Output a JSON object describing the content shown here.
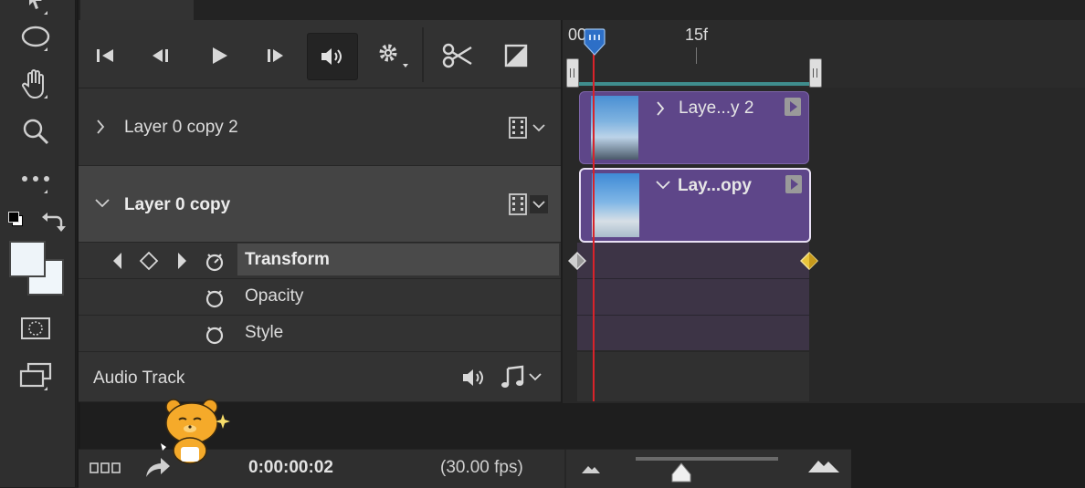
{
  "transport": {
    "buttons": [
      "go-to-first-frame",
      "previous-frame",
      "play",
      "next-frame",
      "mute-audio",
      "settings",
      "split-at-playhead",
      "transition"
    ]
  },
  "layers": [
    {
      "name": "Layer 0 copy 2",
      "expanded": false,
      "selected": false
    },
    {
      "name": "Layer 0 copy",
      "expanded": true,
      "selected": true
    }
  ],
  "properties": [
    {
      "name": "Transform",
      "highlighted": true
    },
    {
      "name": "Opacity",
      "highlighted": false
    },
    {
      "name": "Style",
      "highlighted": false
    }
  ],
  "audio_track": {
    "label": "Audio Track"
  },
  "ruler": {
    "start_label": "00",
    "mid_label": "15f"
  },
  "clips": [
    {
      "label": "Laye...y 2"
    },
    {
      "label": "Lay...opy"
    }
  ],
  "status": {
    "timecode": "0:00:00:02",
    "fps": "(30.00 fps)"
  },
  "colors": {
    "clip": "#5e4689",
    "playhead": "#d9232a",
    "keyframe_active": "#e9c53a",
    "playhead_handle": "#2d6fc7"
  }
}
